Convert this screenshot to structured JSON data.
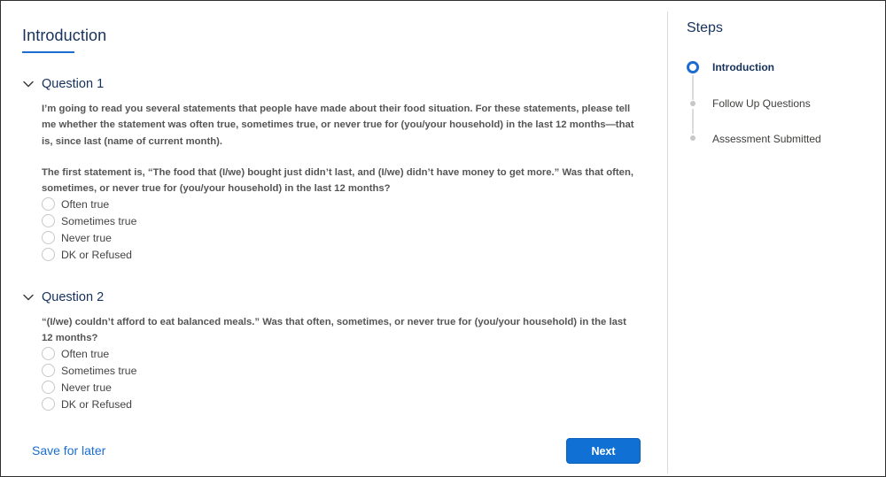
{
  "page": {
    "title": "Introduction"
  },
  "questions": [
    {
      "title": "Question 1",
      "text_p1": "I’m going to read you several statements that people have made about their food situation. For these statements, please tell me whether the statement was often true, sometimes true, or never true for (you/your household) in the last 12 months—that is, since last (name of current month).",
      "text_p2": "The first statement is, “The food that (I/we) bought just didn’t last, and (I/we) didn’t have money to get more.” Was that often, sometimes, or never true for (you/your household) in the last 12 months?",
      "options": [
        "Often true",
        "Sometimes true",
        "Never true",
        "DK or Refused"
      ]
    },
    {
      "title": "Question 2",
      "text_p1": "“(I/we) couldn’t afford to eat balanced meals.” Was that often, sometimes, or never true for (you/your household) in the last 12 months?",
      "options": [
        "Often true",
        "Sometimes true",
        "Never true",
        "DK or Refused"
      ]
    }
  ],
  "footer": {
    "save_label": "Save for later",
    "next_label": "Next"
  },
  "steps": {
    "title": "Steps",
    "items": [
      {
        "label": "Introduction",
        "status": "active"
      },
      {
        "label": "Follow Up Questions",
        "status": "pending"
      },
      {
        "label": "Assessment Submitted",
        "status": "pending"
      }
    ]
  },
  "colors": {
    "accent": "#1b6dd0",
    "heading": "#16325c",
    "button": "#1070d4"
  }
}
